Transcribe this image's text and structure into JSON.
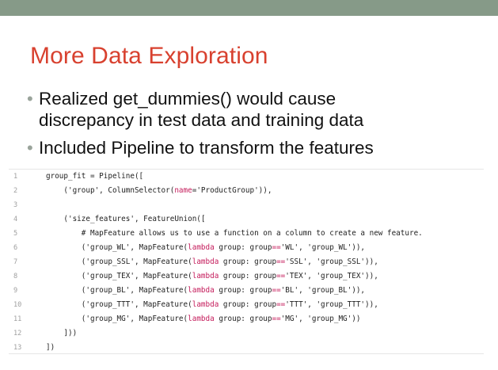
{
  "slide": {
    "title": "More Data Exploration",
    "bullets": [
      {
        "line1": "Realized get_dummies() would cause",
        "line2": "discrepancy in test data and training data"
      },
      {
        "line1": "Included Pipeline to transform the features",
        "line2": ""
      }
    ],
    "bullet_char": "•"
  },
  "code": {
    "lines": [
      {
        "n": "1",
        "text": "group_fit = Pipeline(["
      },
      {
        "n": "2",
        "text": "    ('group', ColumnSelector(name='ProductGroup')),"
      },
      {
        "n": "3",
        "text": ""
      },
      {
        "n": "4",
        "text": "    ('size_features', FeatureUnion(["
      },
      {
        "n": "5",
        "text": "        # MapFeature allows us to use a function on a column to create a new feature."
      },
      {
        "n": "6",
        "text": "        ('group_WL', MapFeature(lambda group: group=='WL', 'group_WL')),"
      },
      {
        "n": "7",
        "text": "        ('group_SSL', MapFeature(lambda group: group=='SSL', 'group_SSL')),"
      },
      {
        "n": "8",
        "text": "        ('group_TEX', MapFeature(lambda group: group=='TEX', 'group_TEX')),"
      },
      {
        "n": "9",
        "text": "        ('group_BL', MapFeature(lambda group: group=='BL', 'group_BL')),"
      },
      {
        "n": "10",
        "text": "        ('group_TTT', MapFeature(lambda group: group=='TTT', 'group_TTT')),"
      },
      {
        "n": "11",
        "text": "        ('group_MG', MapFeature(lambda group: group=='MG', 'group_MG'))"
      },
      {
        "n": "12",
        "text": "    ]))"
      },
      {
        "n": "13",
        "text": "])"
      }
    ]
  },
  "colors": {
    "title": "#d8412f",
    "topbar": "#869a88",
    "keyword": "#c41a5a"
  }
}
